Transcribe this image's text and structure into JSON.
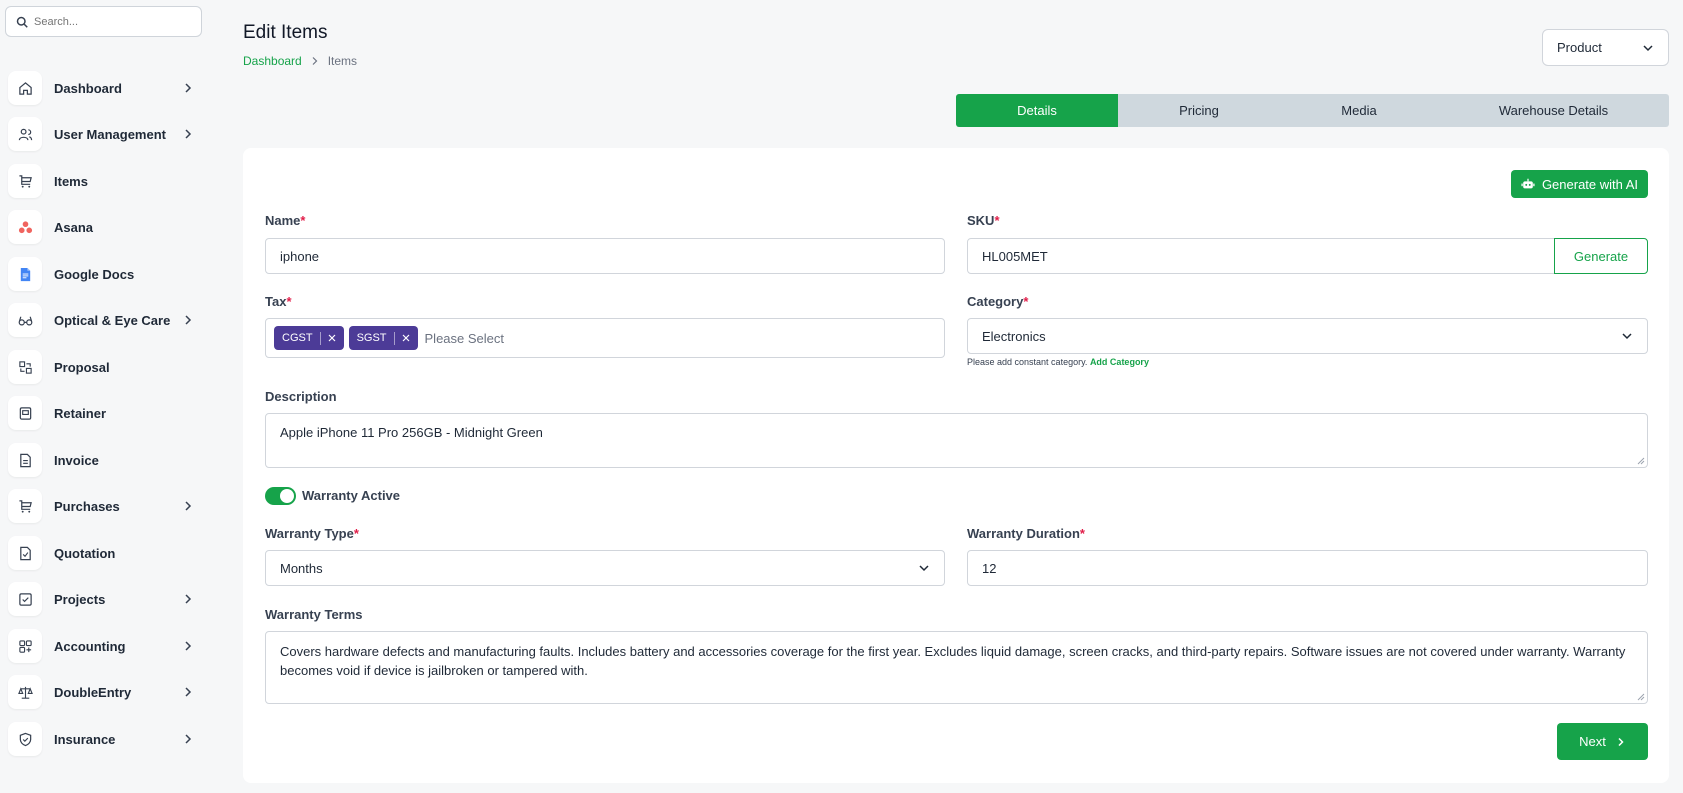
{
  "search": {
    "placeholder": "Search..."
  },
  "sidebar": {
    "items": [
      {
        "label": "Dashboard",
        "icon": "home-icon",
        "chevron": true
      },
      {
        "label": "User Management",
        "icon": "users-icon",
        "chevron": true
      },
      {
        "label": "Items",
        "icon": "cart-icon",
        "chevron": false
      },
      {
        "label": "Asana",
        "icon": "asana-icon",
        "chevron": false
      },
      {
        "label": "Google Docs",
        "icon": "google-docs-icon",
        "chevron": false
      },
      {
        "label": "Optical & Eye Care",
        "icon": "glasses-icon",
        "chevron": true
      },
      {
        "label": "Proposal",
        "icon": "proposal-icon",
        "chevron": false
      },
      {
        "label": "Retainer",
        "icon": "retainer-icon",
        "chevron": false
      },
      {
        "label": "Invoice",
        "icon": "invoice-icon",
        "chevron": false
      },
      {
        "label": "Purchases",
        "icon": "cart-icon",
        "chevron": true
      },
      {
        "label": "Quotation",
        "icon": "quotation-icon",
        "chevron": false
      },
      {
        "label": "Projects",
        "icon": "checkbox-icon",
        "chevron": true
      },
      {
        "label": "Accounting",
        "icon": "accounting-icon",
        "chevron": true
      },
      {
        "label": "DoubleEntry",
        "icon": "scale-icon",
        "chevron": true
      },
      {
        "label": "Insurance",
        "icon": "shield-icon",
        "chevron": true
      }
    ]
  },
  "header": {
    "title": "Edit Items",
    "breadcrumb": {
      "home": "Dashboard",
      "current": "Items"
    },
    "type_select": "Product"
  },
  "tabs": [
    {
      "label": "Details",
      "active": true
    },
    {
      "label": "Pricing",
      "active": false
    },
    {
      "label": "Media",
      "active": false
    },
    {
      "label": "Warehouse Details",
      "active": false
    }
  ],
  "form": {
    "ai_button": "Generate with AI",
    "name": {
      "label": "Name",
      "required": "*",
      "value": "iphone"
    },
    "sku": {
      "label": "SKU",
      "required": "*",
      "value": "HL005MET",
      "button": "Generate"
    },
    "tax": {
      "label": "Tax",
      "required": "*",
      "chips": [
        "CGST",
        "SGST"
      ],
      "placeholder": "Please Select"
    },
    "category": {
      "label": "Category",
      "required": "*",
      "value": "Electronics",
      "hint": "Please add constant category.",
      "hint_link": "Add Category"
    },
    "description": {
      "label": "Description",
      "value": "Apple iPhone 11 Pro 256GB - Midnight Green"
    },
    "warranty_toggle": {
      "label": "Warranty Active",
      "on": true
    },
    "warranty_type": {
      "label": "Warranty Type",
      "required": "*",
      "value": "Months"
    },
    "warranty_duration": {
      "label": "Warranty Duration",
      "required": "*",
      "value": "12"
    },
    "warranty_terms": {
      "label": "Warranty Terms",
      "value": "Covers hardware defects and manufacturing faults. Includes battery and accessories coverage for the first year. Excludes liquid damage, screen cracks, and third-party repairs. Software issues are not covered under warranty. Warranty becomes void if device is jailbroken or tampered with."
    },
    "next_button": "Next"
  },
  "colors": {
    "accent": "#16a34a",
    "chip": "#4c3b97",
    "required": "#e11d48",
    "tab_bar": "#cfd8de"
  }
}
